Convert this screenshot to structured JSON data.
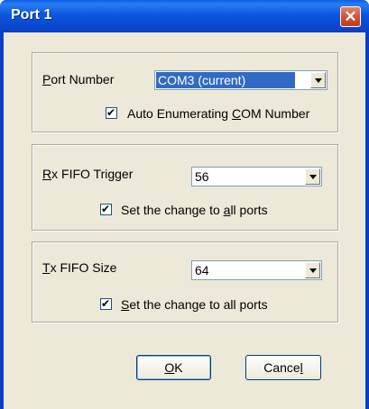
{
  "window": {
    "title": "Port 1"
  },
  "port_group": {
    "label_before": "",
    "label_key": "P",
    "label_after": "ort Number",
    "selected": "COM3 (current)",
    "auto_label_before": "Auto Enumerating ",
    "auto_label_key": "C",
    "auto_label_after": "OM Number",
    "auto_checked": true
  },
  "rx_group": {
    "label_key": "R",
    "label_after": "x FIFO Trigger",
    "selected": "56",
    "set_all_before": "Set the change to ",
    "set_all_key": "a",
    "set_all_after": "ll ports",
    "set_all_checked": true
  },
  "tx_group": {
    "label_key": "T",
    "label_after": "x FIFO Size",
    "selected": "64",
    "set_all_key": "S",
    "set_all_after": "et the change to all ports",
    "set_all_checked": true
  },
  "buttons": {
    "ok_key": "O",
    "ok_after": "K",
    "cancel_before": "Cance",
    "cancel_key": "l"
  }
}
